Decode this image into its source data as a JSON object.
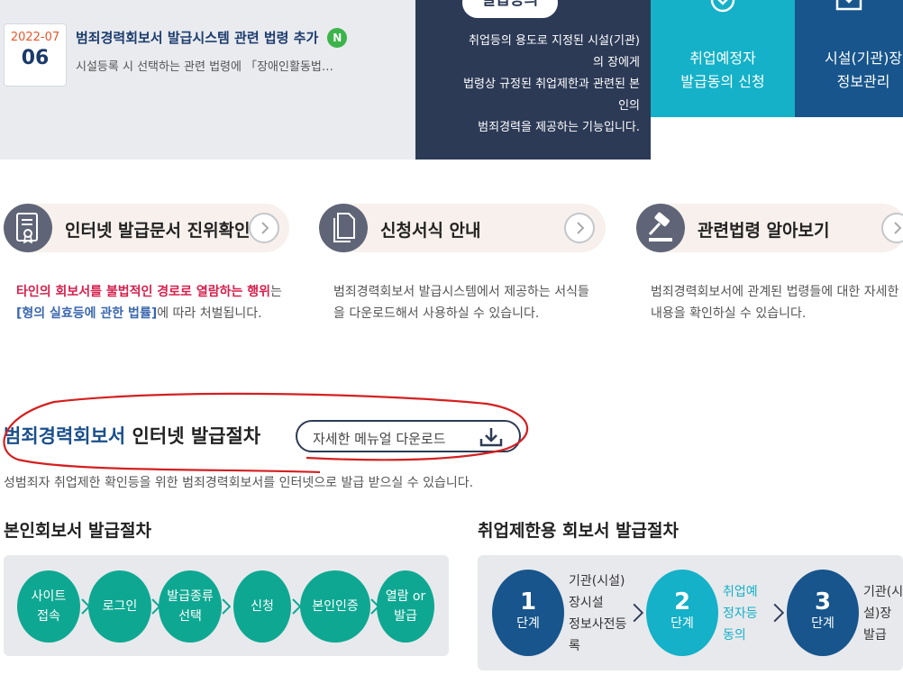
{
  "notice": {
    "year_month": "2022-07",
    "day": "06",
    "title": "범죄경력회보서 발급시스템 관련 법령 추가",
    "badge": "N",
    "desc": "시설등록 시 선택하는 관련 법령에 「장애인활동법…"
  },
  "consent_panel": {
    "pill": "발급동의",
    "text": "취업등의 용도로 지정된 시설(기관)\n의 장에게\n법령상 규정된 취업제한과 관련된 본\n인의\n범죄경력을 제공하는 기능입니다."
  },
  "top_cards": [
    {
      "label": "취업예정자\n발급동의 신청",
      "icon": "check-down-icon"
    },
    {
      "label": "시설(기관)장\n정보관리",
      "icon": "check-down-icon"
    }
  ],
  "services": [
    {
      "title": "인터넷 발급문서 진위확인",
      "icon": "certificate-icon"
    },
    {
      "title": "신청서식 안내",
      "icon": "document-icon"
    },
    {
      "title": "관련법령 알아보기",
      "icon": "gavel-icon"
    }
  ],
  "service_desc": {
    "authenticity": {
      "red": "타인의 회보서를 불법적인 경로로 열람하는 행위",
      "mid": "는 ",
      "blue": "[형의 실효등에 관한 법률]",
      "tail": "에 따라 처벌됩니다."
    },
    "forms": "범죄경력회보서 발급시스템에서 제공하는 서식들을 다운로드해서 사용하실 수 있습니다.",
    "laws": "범죄경력회보서에 관계된 법령들에 대한 자세한 내용을 확인하실 수 있습니다."
  },
  "procedure": {
    "title_highlight": "범죄경력회보서",
    "title_rest": " 인터넷 발급절차",
    "manual_button": "자세한 메뉴얼 다운로드",
    "subtitle": "성범죄자 취업제한 확인등을 위한 범죄경력회보서를 인터넷으로 발급 받으실 수 있습니다."
  },
  "personal": {
    "title": "본인회보서 발급절차",
    "steps": [
      "사이트\n접속",
      "로그인",
      "발급종류\n선택",
      "신청",
      "본인인증",
      "열람 or\n발급"
    ]
  },
  "employment": {
    "title": "취업제한용 회보서 발급절차",
    "step_word": "단계",
    "steps": [
      {
        "num": "1",
        "desc": "기관(시설)\n장시설\n정보사전등\n록",
        "color": "#17558c"
      },
      {
        "num": "2",
        "desc": "취업예\n정자등\n동의",
        "color": "#14b1c8"
      },
      {
        "num": "3",
        "desc": "기관(시\n설)장\n발급",
        "color": "#17558c"
      }
    ]
  },
  "colors": {
    "navy": "#2c3a56",
    "teal": "#14b1c8",
    "blue": "#17558c",
    "green": "#0ea892",
    "warning_red": "#d6204d",
    "annotation_red": "#d42020"
  }
}
